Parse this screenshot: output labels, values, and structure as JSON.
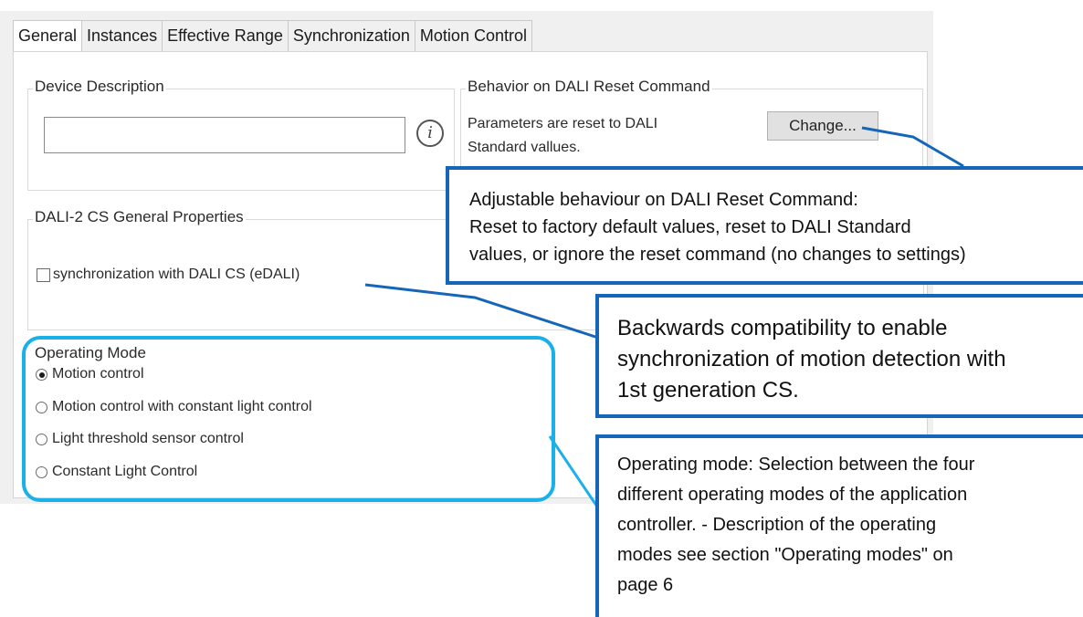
{
  "tabs": [
    {
      "label": "General",
      "active": true
    },
    {
      "label": "Instances"
    },
    {
      "label": "Effective Range"
    },
    {
      "label": "Synchronization"
    },
    {
      "label": "Motion Control"
    }
  ],
  "device_description": {
    "title": "Device Description",
    "value": ""
  },
  "reset_behavior": {
    "title": "Behavior on DALI Reset Command",
    "text_line1": "Parameters are reset to DALI",
    "text_line2": "Standard vallues.",
    "change_button": "Change..."
  },
  "cs_properties": {
    "title": "DALI-2 CS General Properties",
    "sync_checkbox_label": "synchronization with DALI CS (eDALI)",
    "sync_checked": false
  },
  "operating_mode": {
    "title": "Operating Mode",
    "options": [
      {
        "label": "Motion control",
        "selected": true
      },
      {
        "label": "Motion control with constant light control",
        "selected": false
      },
      {
        "label": "Light threshold sensor control",
        "selected": false
      },
      {
        "label": "Constant Light Control",
        "selected": false
      }
    ]
  },
  "callouts": {
    "reset": {
      "line1": "Adjustable behaviour on DALI Reset Command:",
      "line2": "Reset to factory default values, reset to DALI Standard",
      "line3": "values, or ignore the reset command (no changes to settings)"
    },
    "sync": {
      "line1": "Backwards compatibility to enable",
      "line2": "synchronization of motion detection with",
      "line3": "1st generation CS."
    },
    "mode": {
      "line1": "Operating mode: Selection between the four",
      "line2": "different operating modes of the application",
      "line3": "controller. - Description of the operating",
      "line4": "modes see section \"Operating modes\" on",
      "line5": "page 6"
    }
  },
  "colors": {
    "callout_border": "#1565b8",
    "highlight_border": "#19b1e8"
  }
}
